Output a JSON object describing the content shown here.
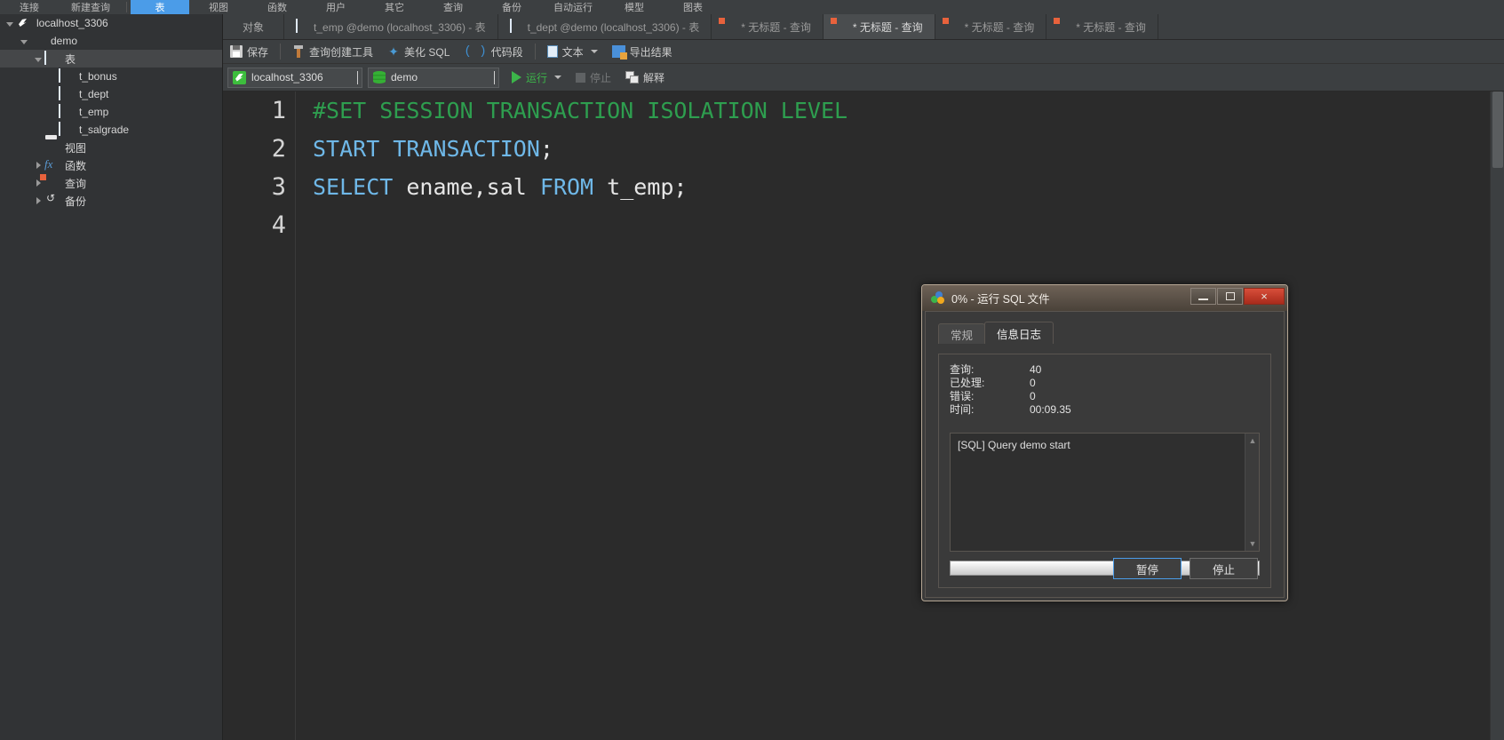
{
  "app": {
    "menubar": [
      {
        "label": "连接",
        "icon": "connection-icon",
        "active": false
      },
      {
        "label": "新建查询",
        "icon": "new-query-icon",
        "active": false
      },
      {
        "label": "表",
        "icon": "table-icon",
        "active": true
      },
      {
        "label": "视图",
        "icon": "view-icon",
        "active": false
      },
      {
        "label": "函数",
        "icon": "function-icon",
        "active": false
      },
      {
        "label": "用户",
        "icon": "user-icon",
        "active": false
      },
      {
        "label": "其它",
        "icon": "other-icon",
        "active": false
      },
      {
        "label": "查询",
        "icon": "query-icon",
        "active": false
      },
      {
        "label": "备份",
        "icon": "backup-icon",
        "active": false
      },
      {
        "label": "自动运行",
        "icon": "autorun-icon",
        "active": false
      },
      {
        "label": "模型",
        "icon": "model-icon",
        "active": false
      },
      {
        "label": "图表",
        "icon": "chart-icon",
        "active": false
      }
    ]
  },
  "sidebar": {
    "tree": [
      {
        "label": "localhost_3306",
        "icon": "server-icon",
        "indent": 0,
        "twisty": "open",
        "selected": false
      },
      {
        "label": "demo",
        "icon": "database-icon",
        "indent": 1,
        "twisty": "open",
        "selected": false
      },
      {
        "label": "表",
        "icon": "table-icon",
        "indent": 2,
        "twisty": "open",
        "selected": true
      },
      {
        "label": "t_bonus",
        "icon": "table-icon",
        "indent": 3,
        "twisty": "none",
        "selected": false
      },
      {
        "label": "t_dept",
        "icon": "table-icon",
        "indent": 3,
        "twisty": "none",
        "selected": false
      },
      {
        "label": "t_emp",
        "icon": "table-icon",
        "indent": 3,
        "twisty": "none",
        "selected": false
      },
      {
        "label": "t_salgrade",
        "icon": "table-icon",
        "indent": 3,
        "twisty": "none",
        "selected": false
      },
      {
        "label": "视图",
        "icon": "view-icon",
        "indent": 2,
        "twisty": "none",
        "selected": false
      },
      {
        "label": "函数",
        "icon": "function-fx-icon",
        "indent": 2,
        "twisty": "closed",
        "selected": false
      },
      {
        "label": "查询",
        "icon": "query-icon",
        "indent": 2,
        "twisty": "closed",
        "selected": false
      },
      {
        "label": "备份",
        "icon": "backup-icon",
        "indent": 2,
        "twisty": "closed",
        "selected": false
      }
    ]
  },
  "tabstrip": {
    "object_label": "对象",
    "tabs": [
      {
        "label": "t_emp @demo (localhost_3306) - 表",
        "icon": "table-icon",
        "active": false
      },
      {
        "label": "t_dept @demo (localhost_3306) - 表",
        "icon": "table-icon",
        "active": false
      },
      {
        "label": "* 无标题 - 查询",
        "icon": "query-icon",
        "active": false
      },
      {
        "label": "* 无标题 - 查询",
        "icon": "query-icon",
        "active": true
      },
      {
        "label": "* 无标题 - 查询",
        "icon": "query-icon",
        "active": false
      },
      {
        "label": "* 无标题 - 查询",
        "icon": "query-icon",
        "active": false
      }
    ]
  },
  "toolbar": {
    "save_label": "保存",
    "query_builder_label": "查询创建工具",
    "beautify_label": "美化 SQL",
    "snippet_label": "代码段",
    "text_label": "文本",
    "export_label": "导出结果"
  },
  "toolbar2": {
    "connection_value": "localhost_3306",
    "database_value": "demo",
    "run_label": "运行",
    "stop_label": "停止",
    "explain_label": "解释"
  },
  "editor": {
    "line_numbers": [
      "1",
      "2",
      "3",
      "4"
    ],
    "lines": [
      [
        {
          "t": "#SET SESSION TRANSACTION ISOLATION LEVEL",
          "c": "comment"
        }
      ],
      [
        {
          "t": "START TRANSACTION",
          "c": "kw"
        },
        {
          "t": ";",
          "c": "punc"
        }
      ],
      [
        {
          "t": "SELECT",
          "c": "kw"
        },
        {
          "t": " ename,sal ",
          "c": "id"
        },
        {
          "t": "FROM",
          "c": "kw"
        },
        {
          "t": " t_emp;",
          "c": "id"
        }
      ],
      []
    ]
  },
  "dialog": {
    "title": "0% - 运行 SQL 文件",
    "window_buttons": {
      "minimize": "minimize-icon",
      "maximize": "maximize-icon",
      "close": "×"
    },
    "tabs": [
      {
        "label": "常规",
        "active": false
      },
      {
        "label": "信息日志",
        "active": true
      }
    ],
    "stats": [
      {
        "label": "查询:",
        "value": "40"
      },
      {
        "label": "已处理:",
        "value": "0"
      },
      {
        "label": "错误:",
        "value": "0"
      },
      {
        "label": "时间:",
        "value": "00:09.35"
      }
    ],
    "log": "[SQL] Query demo start",
    "progress_percent": "0%",
    "buttons": [
      {
        "label": "暂停",
        "primary": true
      },
      {
        "label": "停止",
        "primary": false
      }
    ]
  },
  "colors": {
    "accent": "#4b9ce8",
    "chrome": "#3c3f41",
    "editor_bg": "#2b2b2b",
    "comment_green": "#2e9e4f",
    "keyword_blue": "#6fb8e8",
    "dialog_titlebar": "#6e6257",
    "close_red": "#c0392b"
  }
}
